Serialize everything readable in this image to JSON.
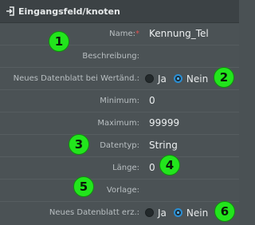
{
  "header": {
    "title": "Eingangsfeld/knoten",
    "icon": "sign-in-icon"
  },
  "fields": {
    "name": {
      "label": "Name:",
      "required_mark": "*",
      "value": "Kennung_Tel"
    },
    "beschreibung": {
      "label": "Beschreibung:",
      "value": ""
    },
    "neues_datenblatt_wert": {
      "label": "Neues Datenblatt bei Wertänd.:",
      "options": [
        "Ja",
        "Nein"
      ],
      "selected": "Nein"
    },
    "minimum": {
      "label": "Minimum:",
      "value": "0"
    },
    "maximum": {
      "label": "Maximum:",
      "value": "99999"
    },
    "datentyp": {
      "label": "Datentyp:",
      "value": "String"
    },
    "laenge": {
      "label": "Länge:",
      "value": "0"
    },
    "vorlage": {
      "label": "Vorlage:",
      "value": ""
    },
    "neues_datenblatt_erz": {
      "label": "Neues Datenblatt erz.:",
      "options": [
        "Ja",
        "Nein"
      ],
      "selected": "Nein"
    }
  },
  "annotations": {
    "b1": "1",
    "b2": "2",
    "b3": "3",
    "b4": "4",
    "b5": "5",
    "b6": "6"
  },
  "colors": {
    "badge": "#22e51c",
    "radio_selected": "#2a8fd4",
    "required": "#e05050"
  }
}
